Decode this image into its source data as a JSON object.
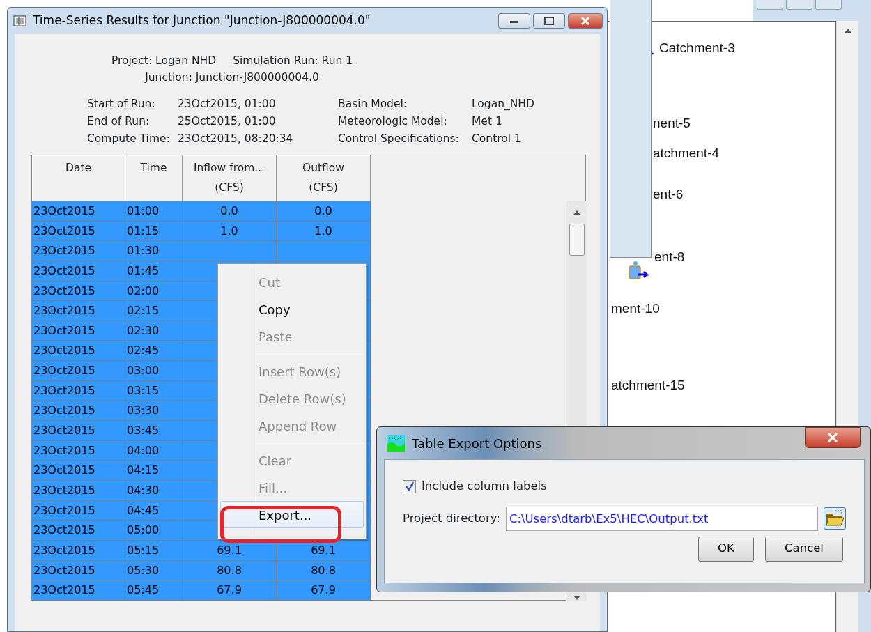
{
  "background_map": {
    "labels": [
      "Catchment-3",
      "nent-5",
      "atchment-4",
      "ent-6",
      "ent-8",
      "ment-10",
      "atchment-15"
    ]
  },
  "main_window": {
    "title": "Time-Series Results for Junction \"Junction-J800000004.0\"",
    "header_lines": [
      [
        "Project: Logan NHD",
        "Simulation Run: Run 1"
      ],
      [
        "Junction: Junction-J800000004.0"
      ]
    ],
    "run_info": [
      {
        "label": "Start of Run:",
        "value": "23Oct2015, 01:00"
      },
      {
        "label": "End of Run:",
        "value": "25Oct2015, 01:00"
      },
      {
        "label": "Compute Time:",
        "value": "23Oct2015, 08:20:34"
      }
    ],
    "model_info": [
      {
        "label": "Basin Model:",
        "value": "Logan_NHD"
      },
      {
        "label": "Meteorologic Model:",
        "value": "Met 1"
      },
      {
        "label": "Control Specifications:",
        "value": "Control 1"
      }
    ],
    "table": {
      "columns": [
        "Date",
        "Time",
        "Inflow from...\n(CFS)",
        "Outflow\n(CFS)"
      ],
      "rows": [
        {
          "date": "23Oct2015",
          "time": "01:00",
          "inflow": "0.0",
          "outflow": "0.0",
          "selected": true
        },
        {
          "date": "23Oct2015",
          "time": "01:15",
          "inflow": "1.0",
          "outflow": "1.0",
          "selected": true
        },
        {
          "date": "23Oct2015",
          "time": "01:30",
          "selected": true
        },
        {
          "date": "23Oct2015",
          "time": "01:45",
          "selected": true
        },
        {
          "date": "23Oct2015",
          "time": "02:00",
          "selected": true
        },
        {
          "date": "23Oct2015",
          "time": "02:15",
          "selected": true
        },
        {
          "date": "23Oct2015",
          "time": "02:30",
          "selected": true
        },
        {
          "date": "23Oct2015",
          "time": "02:45",
          "selected": true
        },
        {
          "date": "23Oct2015",
          "time": "03:00",
          "selected": true
        },
        {
          "date": "23Oct2015",
          "time": "03:15",
          "selected": true
        },
        {
          "date": "23Oct2015",
          "time": "03:30",
          "selected": true
        },
        {
          "date": "23Oct2015",
          "time": "03:45",
          "selected": true
        },
        {
          "date": "23Oct2015",
          "time": "04:00",
          "selected": true
        },
        {
          "date": "23Oct2015",
          "time": "04:15",
          "selected": true
        },
        {
          "date": "23Oct2015",
          "time": "04:30",
          "selected": true
        },
        {
          "date": "23Oct2015",
          "time": "04:45",
          "selected": true
        },
        {
          "date": "23Oct2015",
          "time": "05:00",
          "selected": true
        },
        {
          "date": "23Oct2015",
          "time": "05:15",
          "inflow": "69.1",
          "outflow": "69.1",
          "selected": true
        },
        {
          "date": "23Oct2015",
          "time": "05:30",
          "inflow": "80.8",
          "outflow": "80.8",
          "selected": true
        },
        {
          "date": "23Oct2015",
          "time": "05:45",
          "inflow": "67.9",
          "outflow": "67.9",
          "selected": true
        }
      ]
    }
  },
  "context_menu": {
    "items": [
      {
        "kind": "item",
        "label": "Cut",
        "disabled": true,
        "highlighted": false
      },
      {
        "kind": "item",
        "label": "Copy",
        "disabled": false,
        "highlighted": false
      },
      {
        "kind": "item",
        "label": "Paste",
        "disabled": true,
        "highlighted": false
      },
      {
        "kind": "separator"
      },
      {
        "kind": "item",
        "label": "Insert Row(s)",
        "disabled": true,
        "highlighted": false
      },
      {
        "kind": "item",
        "label": "Delete Row(s)",
        "disabled": true,
        "highlighted": false
      },
      {
        "kind": "item",
        "label": "Append Row",
        "disabled": true,
        "highlighted": false
      },
      {
        "kind": "separator"
      },
      {
        "kind": "item",
        "label": "Clear",
        "disabled": true,
        "highlighted": false
      },
      {
        "kind": "item",
        "label": "Fill...",
        "disabled": true,
        "highlighted": false
      },
      {
        "kind": "item",
        "label": "Export...",
        "disabled": false,
        "highlighted": true,
        "circled": true
      }
    ]
  },
  "export_dialog": {
    "title": "Table Export Options",
    "include_labels": {
      "label": "Include column labels",
      "checked": true
    },
    "directory": {
      "label": "Project directory:",
      "value": "C:\\Users\\dtarb\\Ex5\\HEC\\Output.txt"
    },
    "buttons": [
      "OK",
      "Cancel"
    ]
  }
}
